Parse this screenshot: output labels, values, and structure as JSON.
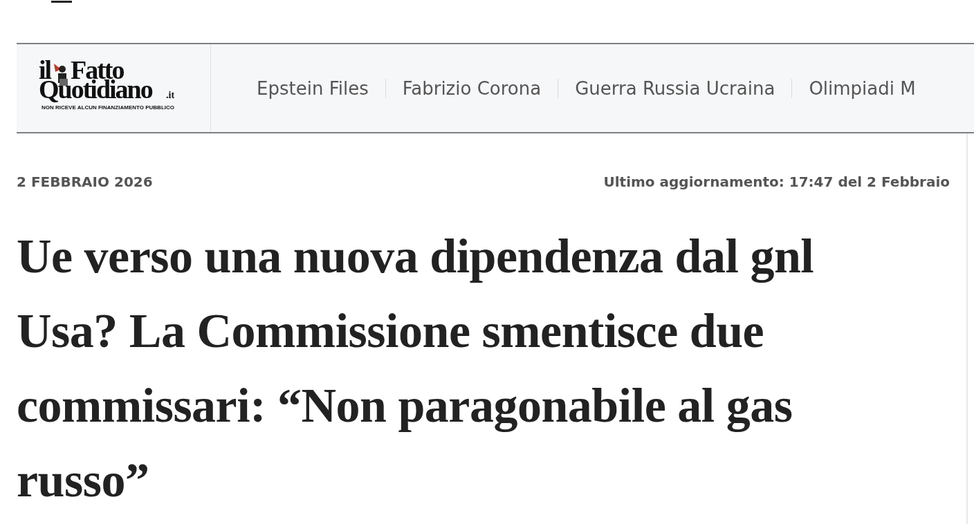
{
  "logo": {
    "prefix": "il",
    "name_top": "Fatto",
    "name_bottom": "Quotidiano",
    "suffix": ".it",
    "tagline": "NON RICEVE ALCUN FINANZIAMENTO PUBBLICO"
  },
  "nav": [
    {
      "label": "Epstein Files"
    },
    {
      "label": "Fabrizio Corona"
    },
    {
      "label": "Guerra Russia Ucraina"
    },
    {
      "label": "Olimpiadi M"
    }
  ],
  "article": {
    "date": "2 FEBBRAIO 2026",
    "updated": "Ultimo aggiornamento: 17:47 del 2 Febbraio",
    "headline": "Ue verso una nuova dipendenza dal gnl Usa? La Commissione smentisce due commissari: “Non paragonabile al gas russo”"
  }
}
